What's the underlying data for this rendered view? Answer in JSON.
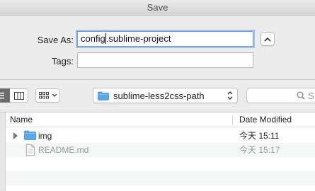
{
  "window": {
    "title": "Save"
  },
  "form": {
    "save_as_label": "Save As:",
    "save_as_value_before_caret": "config",
    "save_as_value_after_caret": ".sublime-project",
    "tags_label": "Tags:",
    "tags_value": ""
  },
  "toolbar": {
    "location": "sublime-less2css-path",
    "search_placeholder": "S"
  },
  "browser": {
    "columns": {
      "name": "Name",
      "date_modified": "Date Modified"
    },
    "rows": [
      {
        "name": "img",
        "date": "今天 15:11",
        "kind": "folder",
        "icon": "folder-icon"
      },
      {
        "name": "README.md",
        "date": "今天 15:17",
        "kind": "file",
        "icon": "document-icon"
      }
    ]
  },
  "colors": {
    "folder": "#5aa8e8",
    "focus_ring": "#9dc1f3",
    "dimmed_text": "#9a9a9a"
  }
}
